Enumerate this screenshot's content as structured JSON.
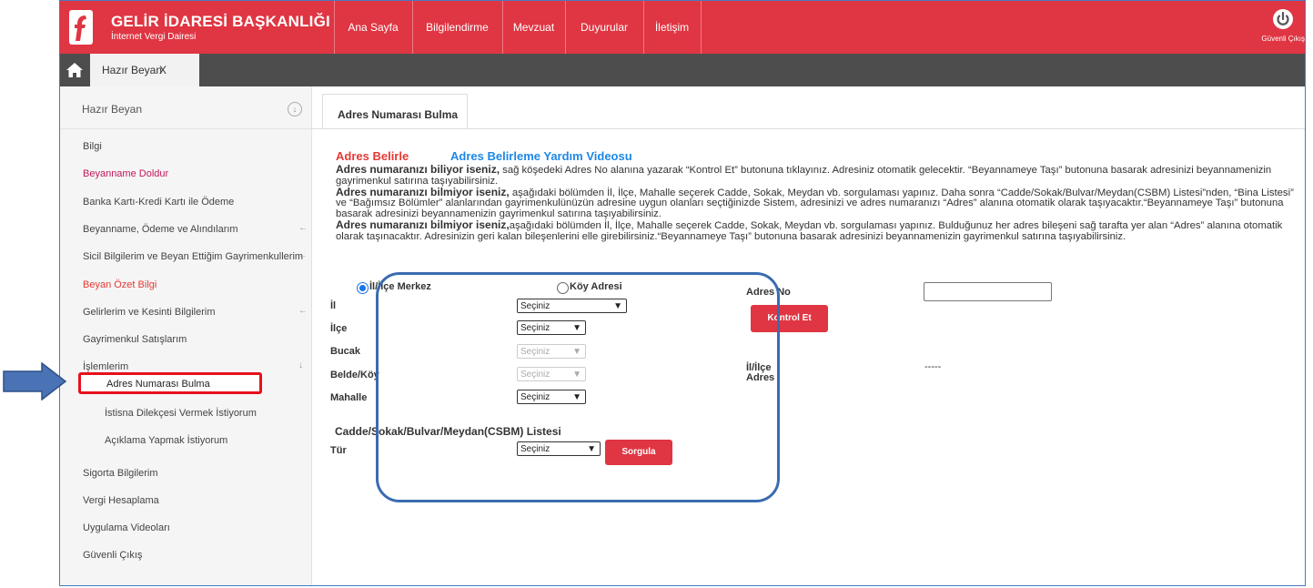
{
  "header": {
    "brand_title": "GELİR İDARESİ BAŞKANLIĞI",
    "brand_sub": "İnternet Vergi Dairesi",
    "nav": [
      "Ana Sayfa",
      "Bilgilendirme",
      "Mevzuat",
      "Duyurular",
      "İletişim"
    ],
    "logout_label": "Güvenli Çıkış",
    "color": "#e03542"
  },
  "tabbar": {
    "tab_label": "Hazır Beyan",
    "tab_close": "X"
  },
  "sidebar": {
    "title": "Hazır Beyan",
    "collapse_icon": "↓",
    "items": [
      {
        "label": "Bilgi"
      },
      {
        "label": "Beyanname Doldur"
      },
      {
        "label": "Banka Kartı-Kredi Kartı ile Ödeme"
      },
      {
        "label": "Beyanname, Ödeme ve Alındılarım",
        "arrow": "←"
      },
      {
        "label": "Sicil Bilgilerim ve Beyan Ettiğim Gayrimenkullerim",
        "arrow": "←"
      },
      {
        "label": "Beyan Özet Bilgi"
      },
      {
        "label": "Gelirlerim ve Kesinti Bilgilerim",
        "arrow": "←"
      },
      {
        "label": "Gayrimenkul Satışlarım"
      },
      {
        "label": "İşlemlerim",
        "arrow": "↓"
      },
      {
        "label": "Adres Numarası Bulma"
      },
      {
        "label": "İstisna Dilekçesi Vermek İstiyorum"
      },
      {
        "label": "Açıklama Yapmak İstiyorum"
      },
      {
        "label": "Sigorta Bilgilerim"
      },
      {
        "label": "Vergi Hesaplama"
      },
      {
        "label": "Uygulama Videoları"
      },
      {
        "label": "Güvenli Çıkış"
      }
    ]
  },
  "main": {
    "tab_label": "Adres Numarası Bulma",
    "section_title": "Adres Belirle",
    "video_link": "Adres Belirleme Yardım Videosu",
    "info": [
      {
        "bold": "Adres numaranızı biliyor iseniz,",
        "text": " sağ köşedeki Adres No alanına yazarak “Kontrol Et” butonuna tıklayınız. Adresiniz otomatik gelecektir. “Beyannameye Taşı” butonuna basarak adresinizi beyannamenizin gayrimenkul satırına taşıyabilirsiniz."
      },
      {
        "bold": "Adres numaranızı bilmiyor iseniz,",
        "text": " aşağıdaki bölümden İl, İlçe, Mahalle seçerek Cadde, Sokak, Meydan vb. sorgulaması yapınız. Daha sonra “Cadde/Sokak/Bulvar/Meydan(CSBM) Listesi”nden, “Bina Listesi” ve “Bağımsız Bölümler” alanlarından gayrimenkulünüzün adresine uygun olanları seçtiğinizde Sistem, adresinizi ve adres numaranızı “Adres” alanına otomatik olarak taşıyacaktır.“Beyannameye Taşı” butonuna basarak adresinizi beyannamenizin gayrimenkul satırına taşıyabilirsiniz."
      },
      {
        "bold": "Adres numaranızı bilmiyor iseniz,",
        "text": "aşağıdaki bölümden İl, İlçe, Mahalle seçerek Cadde, Sokak, Meydan vb. sorgulaması yapınız. Bulduğunuz her adres bileşeni sağ tarafta yer alan “Adres” alanına otomatik olarak taşınacaktır. Adresinizin geri kalan bileşenlerini elle girebilirsiniz.“Beyannameye Taşı” butonuna basarak adresinizi beyannamenizin gayrimenkul satırına taşıyabilirsiniz."
      }
    ],
    "form": {
      "radio_merkez": "İl/İlçe Merkez",
      "radio_koy": "Köy Adresi",
      "selected_radio": "İl/İlçe Merkez",
      "fields": [
        {
          "label": "İl",
          "value": "Seçiniz"
        },
        {
          "label": "İlçe",
          "value": "Seçiniz"
        },
        {
          "label": "Bucak",
          "value": "Seçiniz",
          "disabled": true
        },
        {
          "label": "Belde/Köy",
          "value": "Seçiniz",
          "disabled": true
        },
        {
          "label": "Mahalle",
          "value": "Seçiniz"
        }
      ],
      "csbm_title": "Cadde/Sokak/Bulvar/Meydan(CSBM) Listesi",
      "tur_label": "Tür",
      "tur_value": "Seçiniz",
      "sorgula": "Sorgula"
    },
    "right": {
      "adres_no_label": "Adres No",
      "kontrol_et": "Kontrol Et",
      "il_ilce_label": "İl/İlçe",
      "adres_label": "Adres",
      "il_ilce_value": "-----"
    }
  }
}
